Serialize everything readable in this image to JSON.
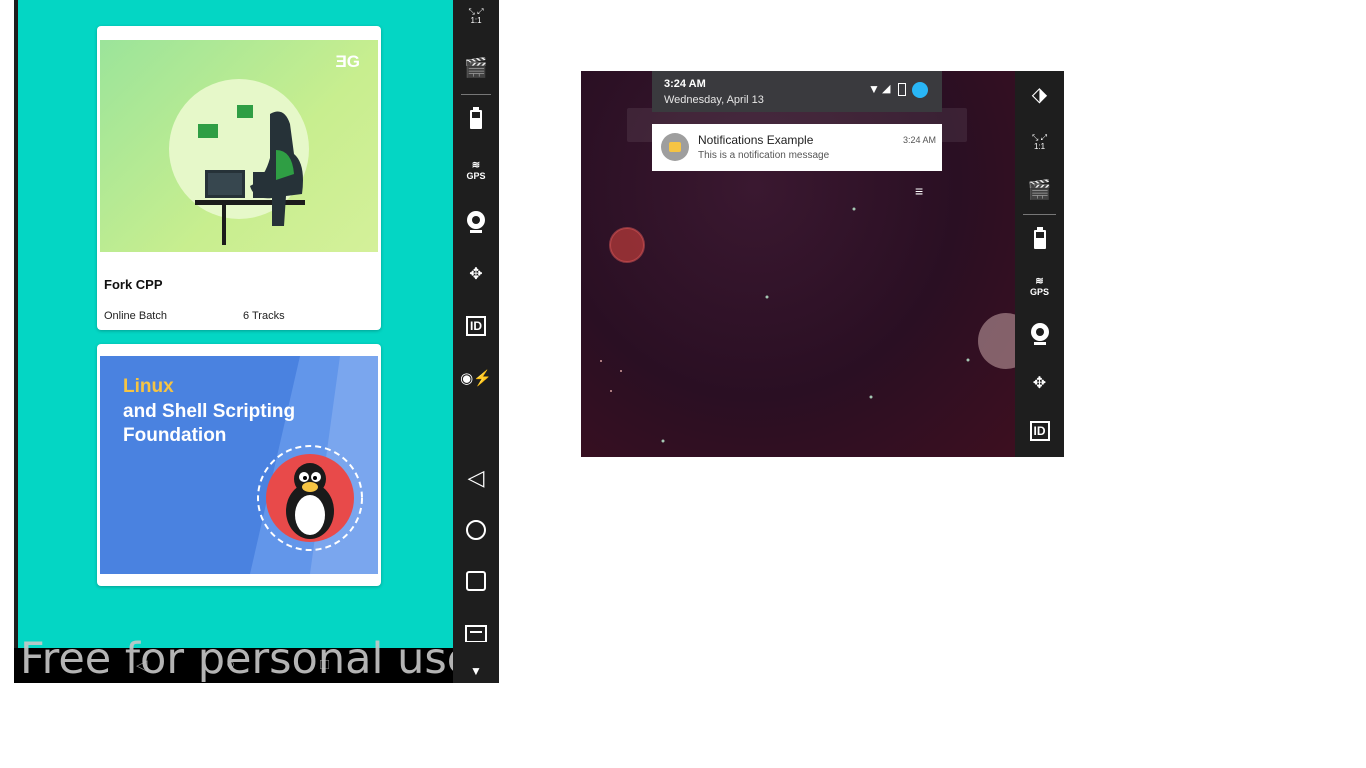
{
  "left_app": {
    "card1": {
      "brand": "ƎG",
      "title": "Fork CPP",
      "meta_left": "Online Batch",
      "meta_right": "6 Tracks"
    },
    "card2": {
      "line1": "Linux",
      "line2": "and Shell Scripting",
      "line3": "Foundation"
    },
    "watermark": "Free for personal use"
  },
  "right_app": {
    "status": {
      "time": "3:24 AM",
      "date": "Wednesday, April 13"
    },
    "notification": {
      "title": "Notifications Example",
      "message": "This is a notification message",
      "time": "3:24 AM"
    }
  },
  "sidebar_icons": {
    "ratio_label": "1:1",
    "gps_label": "GPS",
    "id_label": "ID"
  },
  "colors": {
    "app_background": "#04d6c4",
    "sidebar": "#1e1e1e",
    "card2_background": "#4a82e0",
    "linux_accent": "#f6c443"
  }
}
